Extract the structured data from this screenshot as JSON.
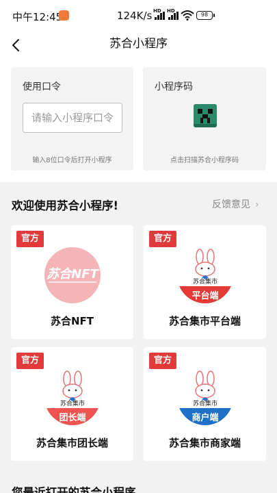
{
  "status": {
    "time": "中午12:45",
    "network": "124K/s",
    "battery": "98",
    "hd": "HD"
  },
  "nav": {
    "title": "苏合小程序"
  },
  "passcode": {
    "label": "使用口令",
    "placeholder": "请输入小程序口令",
    "hint": "输入8位口令后打开小程序"
  },
  "qrcode": {
    "label": "小程序码",
    "hint": "点击扫描苏合小程序码"
  },
  "section": {
    "title": "欢迎使用苏合小程序!",
    "feedback": "反馈意见"
  },
  "cards": [
    {
      "tag": "官方",
      "name": "苏合NFT",
      "logo_text": "苏合NFT"
    },
    {
      "tag": "官方",
      "name": "苏合集市平台端",
      "logo_caption": "苏合集市",
      "logo_band": "平台端",
      "band_color": "#e53935"
    },
    {
      "tag": "官方",
      "name": "苏合集市团长端",
      "logo_caption": "苏合集市",
      "logo_band": "团长端",
      "band_color": "#ef5350"
    },
    {
      "tag": "官方",
      "name": "苏合集市商家端",
      "logo_caption": "苏合集市",
      "logo_band": "商户端",
      "band_color": "#1e70c8"
    }
  ],
  "recent": {
    "title": "您最近打开的苏合小程序"
  },
  "colors": {
    "tag_red": "#e23a3a",
    "accent_orange": "#f07a3a"
  }
}
